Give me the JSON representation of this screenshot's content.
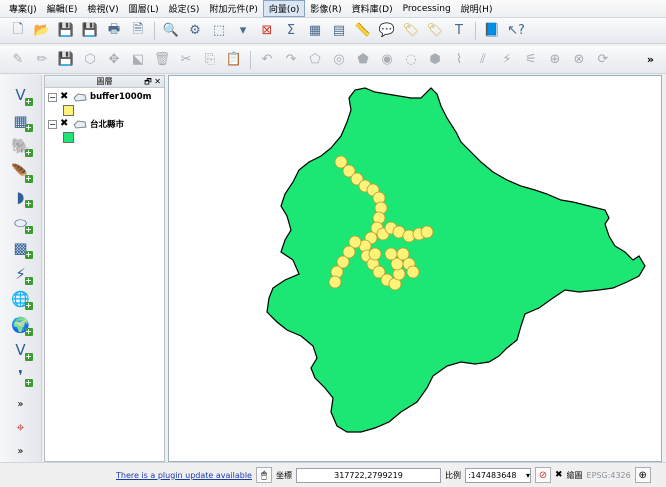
{
  "menubar": {
    "items": [
      "專案(J)",
      "編輯(E)",
      "檢視(V)",
      "圖層(L)",
      "設定(S)",
      "附加元件(P)",
      "向量(o)",
      "影像(R)",
      "資料庫(D)",
      "Processing",
      "說明(H)"
    ],
    "active_index": 6
  },
  "toolbar_top": {
    "icons": [
      "new-project-icon",
      "open-project-icon",
      "save-project-icon",
      "save-as-icon",
      "new-print-composer-icon",
      "composer-manager-icon",
      "pan-map-icon",
      "zoom-in-icon",
      "select-icon",
      "identify-icon",
      "measure-icon",
      "sum-icon",
      "attribute-table-icon",
      "field-calc-icon",
      "measure-line-icon",
      "annotation-icon",
      "label-icon",
      "move-label-icon",
      "text-annotation-icon",
      "help-book-icon",
      "whats-this-icon"
    ]
  },
  "toolbar_edit": {
    "icons": [
      "current-edits-icon",
      "toggle-editing-icon",
      "save-edits-icon",
      "add-feature-icon",
      "move-feature-icon",
      "node-tool-icon",
      "delete-selected-icon",
      "cut-features-icon",
      "copy-features-icon",
      "paste-features-icon",
      "undo-icon",
      "redo-icon",
      "simplify-icon",
      "add-ring-icon",
      "add-part-icon",
      "fill-ring-icon",
      "delete-ring-icon",
      "delete-part-icon",
      "reshape-icon",
      "offset-curve-icon",
      "split-features-icon",
      "split-parts-icon",
      "merge-features-icon",
      "merge-attributes-icon",
      "rotate-symbol-icon"
    ],
    "more": "»"
  },
  "layers_panel": {
    "title": "圖層",
    "layers": [
      {
        "name": "buffer1000m",
        "color": "#fdf27a"
      },
      {
        "name": "台北縣市",
        "color": "#1ce674"
      }
    ]
  },
  "status": {
    "plugin_message": "There is a plugin update available",
    "coordinate_label": "坐標",
    "coordinate_value": "317722,2799219",
    "scale_label": "比例",
    "scale_value": ":147483648",
    "render_label": "繪圖",
    "crs": "EPSG:4326"
  },
  "map": {
    "region_color": "#1ce674",
    "buffer_color": "#fdf27a"
  }
}
